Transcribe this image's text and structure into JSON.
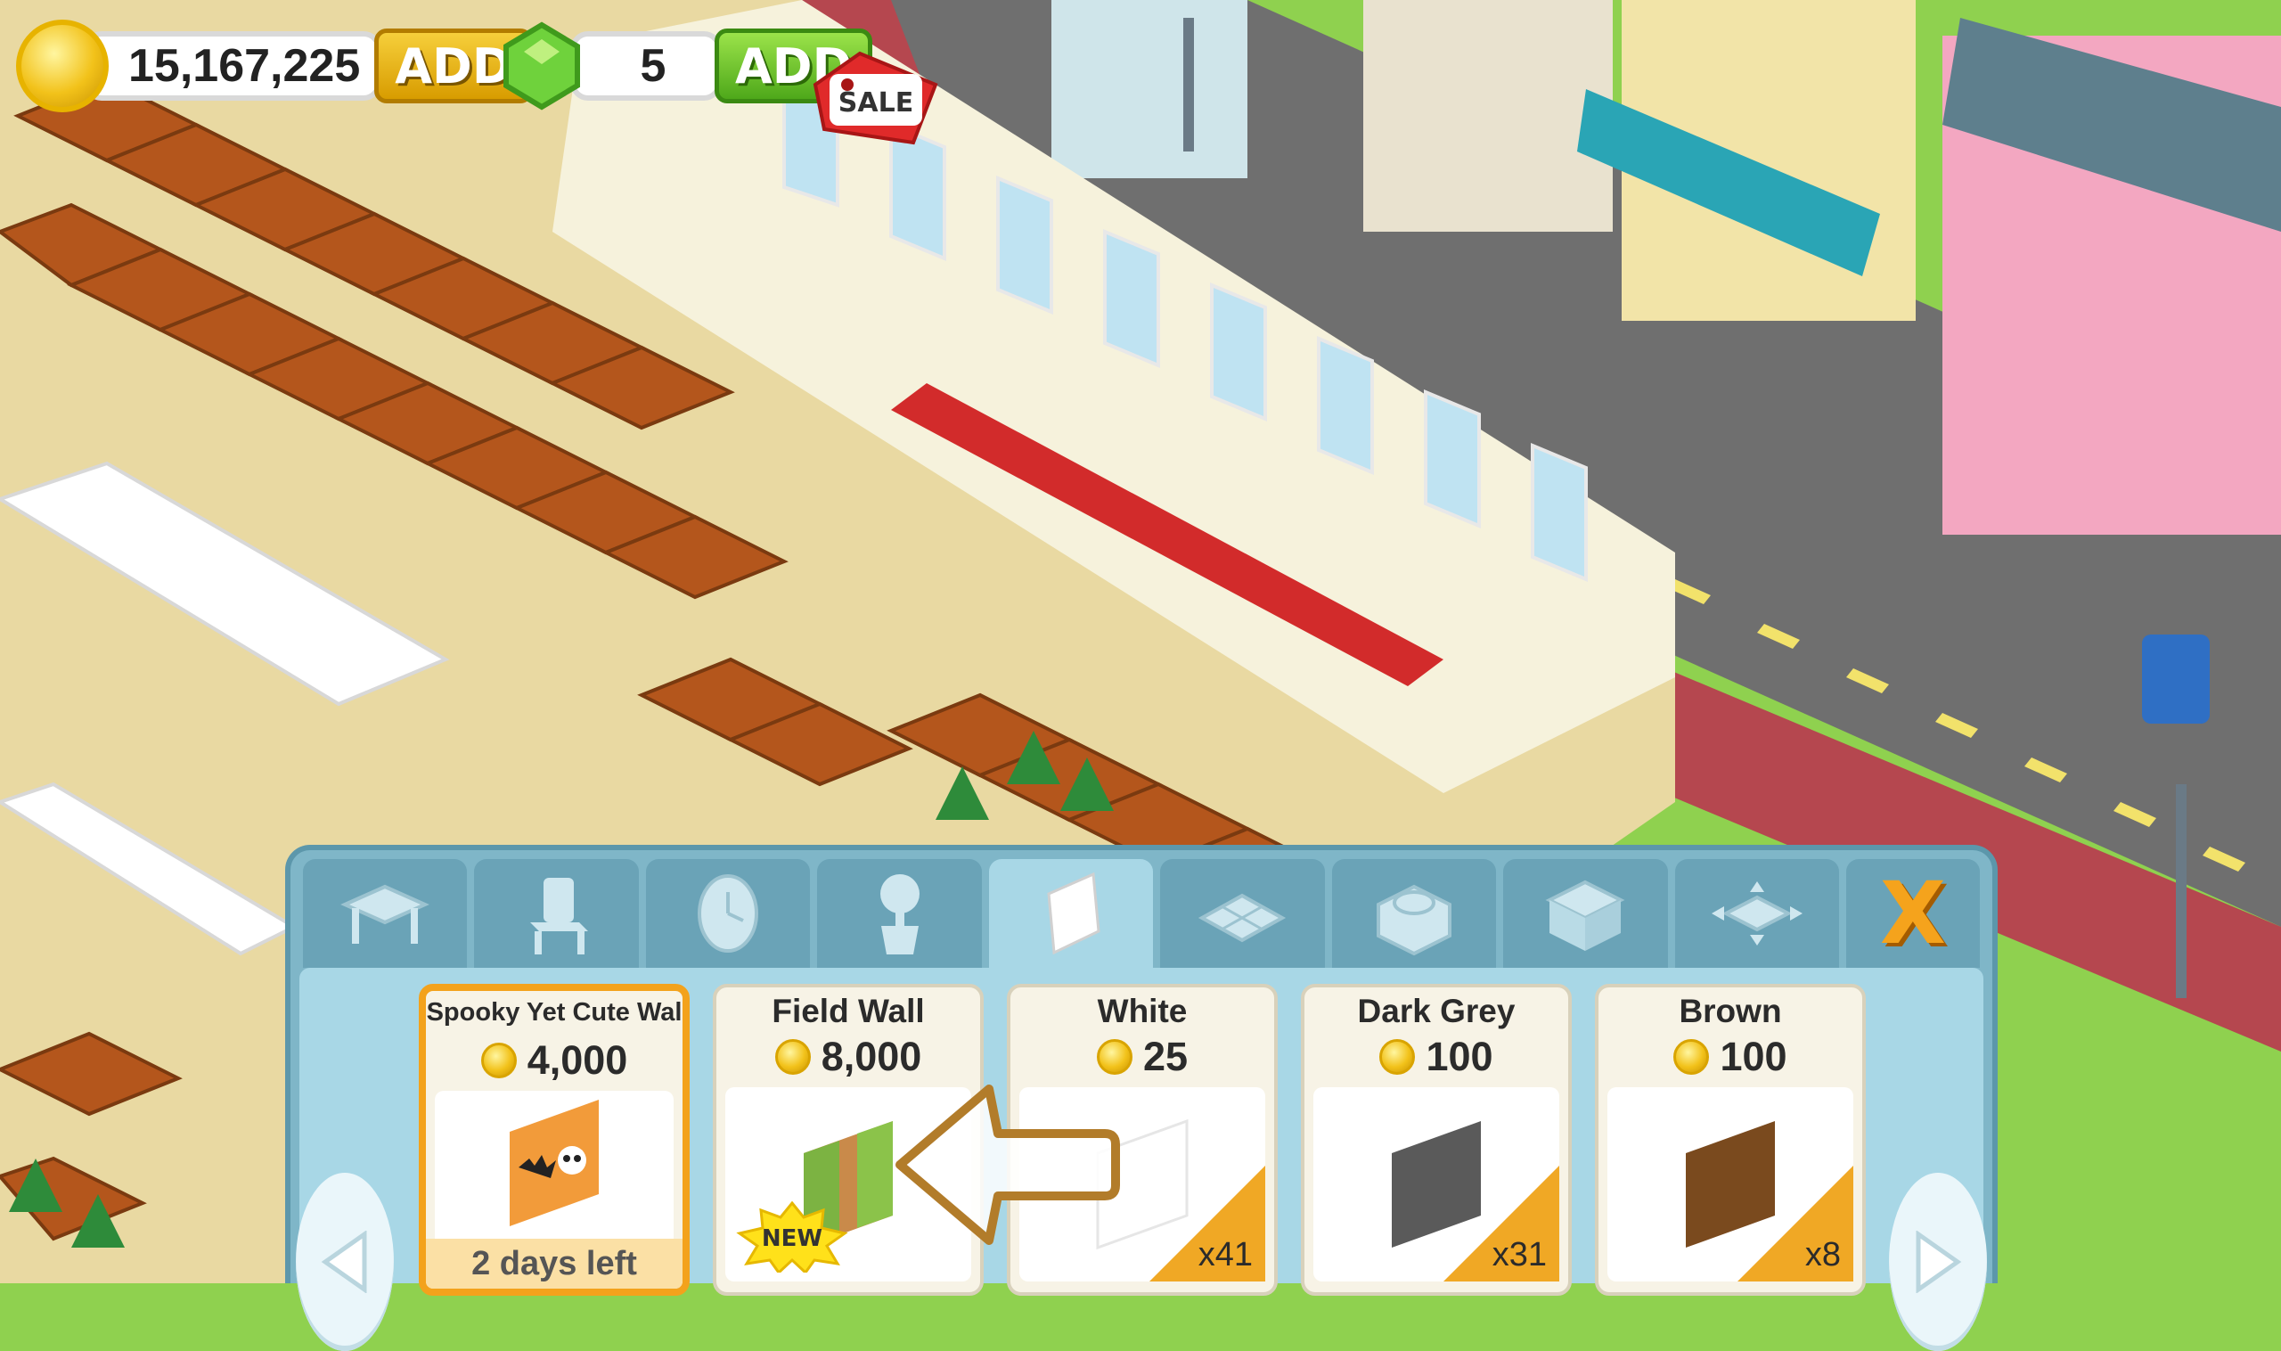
{
  "hud": {
    "coins": "15,167,225",
    "coins_add_label": "ADD",
    "gems": "5",
    "gems_add_label": "ADD",
    "sale_label": "SALE"
  },
  "shop": {
    "tabs": [
      {
        "icon": "table-icon"
      },
      {
        "icon": "chair-icon"
      },
      {
        "icon": "clock-icon"
      },
      {
        "icon": "plant-icon"
      },
      {
        "icon": "wall-icon",
        "active": true
      },
      {
        "icon": "floor-tile-icon"
      },
      {
        "icon": "stove-icon"
      },
      {
        "icon": "counter-icon"
      },
      {
        "icon": "expand-icon"
      }
    ],
    "close_label": "X",
    "items": [
      {
        "name": "Spooky Yet Cute Wal",
        "price": "4,000",
        "timer": "2 days left",
        "color": "#f29b3a"
      },
      {
        "name": "Field Wall",
        "price": "8,000",
        "badge": "NEW",
        "color": "#7cb342"
      },
      {
        "name": "White",
        "price": "25",
        "qty": "x41",
        "color": "#ffffff"
      },
      {
        "name": "Dark Grey",
        "price": "100",
        "qty": "x31",
        "color": "#5a5a5a"
      },
      {
        "name": "Brown",
        "price": "100",
        "qty": "x8",
        "color": "#7a4a1e"
      }
    ]
  },
  "colors": {
    "panel": "#7fb6c8",
    "shelf": "#a8d7e6",
    "card": "#f7f3e6",
    "selected_border": "#f3a21c",
    "coin": "#f2c21a"
  }
}
